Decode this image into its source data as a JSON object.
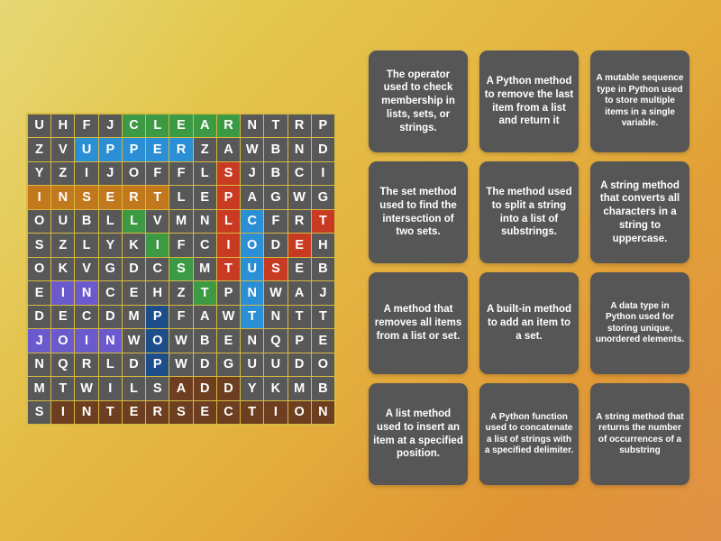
{
  "background": {
    "gradient_start": "#e2d05a",
    "gradient_end": "#dd8530"
  },
  "puzzle": {
    "type": "word-search",
    "columns": 12,
    "rows": 11,
    "cell_default_color": "#585858",
    "highlight_colors": {
      "green": "#3c9a45",
      "blue": "#2b8fd6",
      "red": "#c93a23",
      "orange": "#c2791e",
      "purple": "#6a5acd",
      "navy": "#1e4d8c",
      "brown": "#6d3f20"
    },
    "grid": [
      [
        {
          "letter": "U",
          "color": ""
        },
        {
          "letter": "H",
          "color": ""
        },
        {
          "letter": "F",
          "color": ""
        },
        {
          "letter": "J",
          "color": ""
        },
        {
          "letter": "C",
          "color": "green"
        },
        {
          "letter": "L",
          "color": "green"
        },
        {
          "letter": "E",
          "color": "green"
        },
        {
          "letter": "A",
          "color": "green"
        },
        {
          "letter": "R",
          "color": "green"
        },
        {
          "letter": "N",
          "color": ""
        },
        {
          "letter": "T",
          "color": ""
        },
        {
          "letter": "R",
          "color": ""
        },
        {
          "letter": "P",
          "color": ""
        }
      ],
      [
        {
          "letter": "Z",
          "color": ""
        },
        {
          "letter": "V",
          "color": ""
        },
        {
          "letter": "U",
          "color": "blue"
        },
        {
          "letter": "P",
          "color": "blue"
        },
        {
          "letter": "P",
          "color": "blue"
        },
        {
          "letter": "E",
          "color": "blue"
        },
        {
          "letter": "R",
          "color": "blue"
        },
        {
          "letter": "Z",
          "color": ""
        },
        {
          "letter": "A",
          "color": ""
        },
        {
          "letter": "W",
          "color": ""
        },
        {
          "letter": "B",
          "color": ""
        },
        {
          "letter": "N",
          "color": ""
        },
        {
          "letter": "D",
          "color": ""
        }
      ],
      [
        {
          "letter": "Y",
          "color": ""
        },
        {
          "letter": "Z",
          "color": ""
        },
        {
          "letter": "I",
          "color": ""
        },
        {
          "letter": "J",
          "color": ""
        },
        {
          "letter": "O",
          "color": ""
        },
        {
          "letter": "F",
          "color": ""
        },
        {
          "letter": "F",
          "color": ""
        },
        {
          "letter": "L",
          "color": ""
        },
        {
          "letter": "S",
          "color": "red"
        },
        {
          "letter": "J",
          "color": ""
        },
        {
          "letter": "B",
          "color": ""
        },
        {
          "letter": "C",
          "color": ""
        },
        {
          "letter": "I",
          "color": ""
        }
      ],
      [
        {
          "letter": "I",
          "color": "orange"
        },
        {
          "letter": "N",
          "color": "orange"
        },
        {
          "letter": "S",
          "color": "orange"
        },
        {
          "letter": "E",
          "color": "orange"
        },
        {
          "letter": "R",
          "color": "orange"
        },
        {
          "letter": "T",
          "color": "orange"
        },
        {
          "letter": "L",
          "color": ""
        },
        {
          "letter": "E",
          "color": ""
        },
        {
          "letter": "P",
          "color": "red"
        },
        {
          "letter": "A",
          "color": ""
        },
        {
          "letter": "G",
          "color": ""
        },
        {
          "letter": "W",
          "color": ""
        },
        {
          "letter": "G",
          "color": ""
        }
      ],
      [
        {
          "letter": "O",
          "color": ""
        },
        {
          "letter": "U",
          "color": ""
        },
        {
          "letter": "B",
          "color": ""
        },
        {
          "letter": "L",
          "color": ""
        },
        {
          "letter": "L",
          "color": "green"
        },
        {
          "letter": "V",
          "color": ""
        },
        {
          "letter": "M",
          "color": ""
        },
        {
          "letter": "N",
          "color": ""
        },
        {
          "letter": "L",
          "color": "red"
        },
        {
          "letter": "C",
          "color": "blue"
        },
        {
          "letter": "F",
          "color": ""
        },
        {
          "letter": "R",
          "color": ""
        },
        {
          "letter": "T",
          "color": "red"
        }
      ],
      [
        {
          "letter": "S",
          "color": ""
        },
        {
          "letter": "Z",
          "color": ""
        },
        {
          "letter": "L",
          "color": ""
        },
        {
          "letter": "Y",
          "color": ""
        },
        {
          "letter": "K",
          "color": ""
        },
        {
          "letter": "I",
          "color": "green"
        },
        {
          "letter": "F",
          "color": ""
        },
        {
          "letter": "C",
          "color": ""
        },
        {
          "letter": "I",
          "color": "red"
        },
        {
          "letter": "O",
          "color": "blue"
        },
        {
          "letter": "D",
          "color": ""
        },
        {
          "letter": "E",
          "color": "red"
        },
        {
          "letter": "H",
          "color": ""
        }
      ],
      [
        {
          "letter": "O",
          "color": ""
        },
        {
          "letter": "K",
          "color": ""
        },
        {
          "letter": "V",
          "color": ""
        },
        {
          "letter": "G",
          "color": ""
        },
        {
          "letter": "D",
          "color": ""
        },
        {
          "letter": "C",
          "color": ""
        },
        {
          "letter": "S",
          "color": "green"
        },
        {
          "letter": "M",
          "color": ""
        },
        {
          "letter": "T",
          "color": "red"
        },
        {
          "letter": "U",
          "color": "blue"
        },
        {
          "letter": "S",
          "color": "red"
        },
        {
          "letter": "E",
          "color": ""
        },
        {
          "letter": "B",
          "color": ""
        }
      ],
      [
        {
          "letter": "E",
          "color": ""
        },
        {
          "letter": "I",
          "color": "purple"
        },
        {
          "letter": "N",
          "color": "purple"
        },
        {
          "letter": "C",
          "color": ""
        },
        {
          "letter": "E",
          "color": ""
        },
        {
          "letter": "H",
          "color": ""
        },
        {
          "letter": "Z",
          "color": ""
        },
        {
          "letter": "T",
          "color": "green"
        },
        {
          "letter": "P",
          "color": ""
        },
        {
          "letter": "N",
          "color": "blue"
        },
        {
          "letter": "W",
          "color": ""
        },
        {
          "letter": "A",
          "color": ""
        },
        {
          "letter": "J",
          "color": ""
        }
      ],
      [
        {
          "letter": "D",
          "color": ""
        },
        {
          "letter": "E",
          "color": ""
        },
        {
          "letter": "C",
          "color": ""
        },
        {
          "letter": "D",
          "color": ""
        },
        {
          "letter": "M",
          "color": ""
        },
        {
          "letter": "P",
          "color": "navy"
        },
        {
          "letter": "F",
          "color": ""
        },
        {
          "letter": "A",
          "color": ""
        },
        {
          "letter": "W",
          "color": ""
        },
        {
          "letter": "T",
          "color": "blue"
        },
        {
          "letter": "N",
          "color": ""
        },
        {
          "letter": "T",
          "color": ""
        },
        {
          "letter": "T",
          "color": ""
        }
      ],
      [
        {
          "letter": "J",
          "color": "purple"
        },
        {
          "letter": "O",
          "color": "purple"
        },
        {
          "letter": "I",
          "color": "purple"
        },
        {
          "letter": "N",
          "color": "purple"
        },
        {
          "letter": "W",
          "color": ""
        },
        {
          "letter": "O",
          "color": "navy"
        },
        {
          "letter": "W",
          "color": ""
        },
        {
          "letter": "B",
          "color": ""
        },
        {
          "letter": "E",
          "color": ""
        },
        {
          "letter": "N",
          "color": ""
        },
        {
          "letter": "Q",
          "color": ""
        },
        {
          "letter": "P",
          "color": ""
        },
        {
          "letter": "E",
          "color": ""
        }
      ],
      [
        {
          "letter": "N",
          "color": ""
        },
        {
          "letter": "Q",
          "color": ""
        },
        {
          "letter": "R",
          "color": ""
        },
        {
          "letter": "L",
          "color": ""
        },
        {
          "letter": "D",
          "color": ""
        },
        {
          "letter": "P",
          "color": "navy"
        },
        {
          "letter": "W",
          "color": ""
        },
        {
          "letter": "D",
          "color": ""
        },
        {
          "letter": "G",
          "color": ""
        },
        {
          "letter": "U",
          "color": ""
        },
        {
          "letter": "U",
          "color": ""
        },
        {
          "letter": "D",
          "color": ""
        },
        {
          "letter": "O",
          "color": ""
        }
      ],
      [
        {
          "letter": "M",
          "color": ""
        },
        {
          "letter": "T",
          "color": ""
        },
        {
          "letter": "W",
          "color": ""
        },
        {
          "letter": "I",
          "color": ""
        },
        {
          "letter": "L",
          "color": ""
        },
        {
          "letter": "S",
          "color": ""
        },
        {
          "letter": "A",
          "color": "brown"
        },
        {
          "letter": "D",
          "color": "brown"
        },
        {
          "letter": "D",
          "color": "brown"
        },
        {
          "letter": "Y",
          "color": ""
        },
        {
          "letter": "K",
          "color": ""
        },
        {
          "letter": "M",
          "color": ""
        },
        {
          "letter": "B",
          "color": ""
        }
      ],
      [
        {
          "letter": "S",
          "color": ""
        },
        {
          "letter": "I",
          "color": "brown"
        },
        {
          "letter": "N",
          "color": "brown"
        },
        {
          "letter": "T",
          "color": "brown"
        },
        {
          "letter": "E",
          "color": "brown"
        },
        {
          "letter": "R",
          "color": "brown"
        },
        {
          "letter": "S",
          "color": "brown"
        },
        {
          "letter": "E",
          "color": "brown"
        },
        {
          "letter": "C",
          "color": "brown"
        },
        {
          "letter": "T",
          "color": "brown"
        },
        {
          "letter": "I",
          "color": "brown"
        },
        {
          "letter": "O",
          "color": "brown"
        },
        {
          "letter": "N",
          "color": "brown"
        }
      ]
    ]
  },
  "clues": [
    {
      "text": "The operator used to check membership in lists, sets, or strings.",
      "size": "normal"
    },
    {
      "text": "A Python method to remove the last item from a list and return it",
      "size": "normal"
    },
    {
      "text": "A mutable sequence type in Python used to store multiple items in a single variable.",
      "size": "small"
    },
    {
      "text": "The set method used to find the intersection of two sets.",
      "size": "normal"
    },
    {
      "text": "The method used to split a string into a list of substrings.",
      "size": "normal"
    },
    {
      "text": "A string method that converts all characters in a string to uppercase.",
      "size": "normal"
    },
    {
      "text": "A method that removes all items from a list or set.",
      "size": "normal"
    },
    {
      "text": "A built-in method to add an item to a set.",
      "size": "normal"
    },
    {
      "text": "A data type in Python used for storing unique, unordered elements.",
      "size": "small"
    },
    {
      "text": "A list method used to insert an item at a specified position.",
      "size": "normal"
    },
    {
      "text": "A Python function used to concatenate a list of strings with a specified delimiter.",
      "size": "small"
    },
    {
      "text": "A string method that returns the number of occurrences of a substring",
      "size": "small"
    }
  ]
}
